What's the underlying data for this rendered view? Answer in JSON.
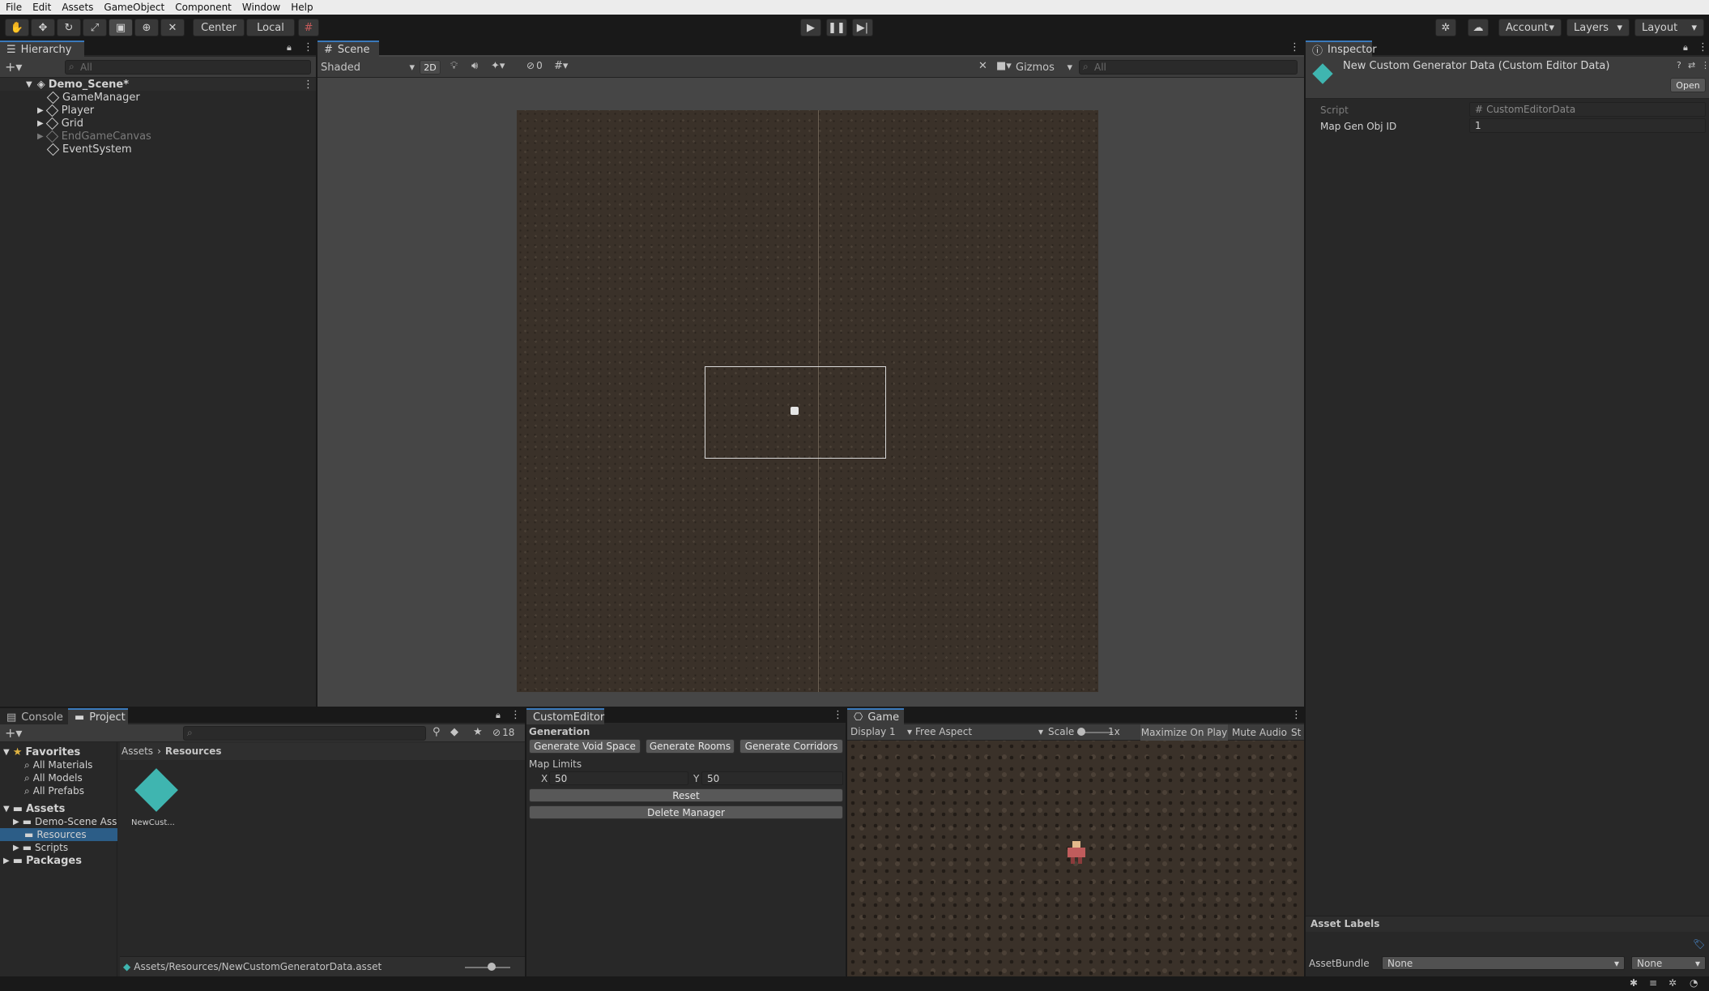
{
  "menu": [
    "File",
    "Edit",
    "Assets",
    "GameObject",
    "Component",
    "Window",
    "Help"
  ],
  "toolbar": {
    "center": "Center",
    "local": "Local",
    "account": "Account",
    "layers": "Layers",
    "layout": "Layout"
  },
  "hierarchy": {
    "tab": "Hierarchy",
    "search_placeholder": "All",
    "scene": "Demo_Scene*",
    "items": [
      "GameManager",
      "Player",
      "Grid",
      "EndGameCanvas",
      "EventSystem"
    ]
  },
  "scene": {
    "tab": "Scene",
    "shading": "Shaded",
    "mode_2d": "2D",
    "hidden_count": "0",
    "gizmos": "Gizmos",
    "search_placeholder": "All"
  },
  "inspector": {
    "tab": "Inspector",
    "title": "New Custom Generator Data (Custom Editor Data)",
    "open_button": "Open",
    "script_label": "Script",
    "script_value": "CustomEditorData",
    "map_gen_label": "Map Gen Obj ID",
    "map_gen_value": "1",
    "asset_labels": "Asset Labels",
    "assetbundle_label": "AssetBundle",
    "assetbundle_value": "None",
    "variant_value": "None"
  },
  "project": {
    "tab_console": "Console",
    "tab_project": "Project",
    "hidden_count": "18",
    "favorites": "Favorites",
    "fav_items": [
      "All Materials",
      "All Models",
      "All Prefabs"
    ],
    "assets": "Assets",
    "asset_folders": [
      "Demo-Scene Ass",
      "Resources",
      "Scripts"
    ],
    "packages": "Packages",
    "breadcrumb_root": "Assets",
    "breadcrumb_current": "Resources",
    "asset_name": "NewCust...",
    "status_path": "Assets/Resources/NewCustomGeneratorData.asset"
  },
  "custom_editor": {
    "tab": "CustomEditor",
    "generation": "Generation",
    "btn_void": "Generate Void Space",
    "btn_rooms": "Generate Rooms",
    "btn_corridors": "Generate Corridors",
    "map_limits": "Map Limits",
    "x_label": "X",
    "x_value": "50",
    "y_label": "Y",
    "y_value": "50",
    "reset": "Reset",
    "delete": "Delete Manager"
  },
  "game": {
    "tab": "Game",
    "display": "Display 1",
    "aspect": "Free Aspect",
    "scale_label": "Scale",
    "scale_value": "1x",
    "maximize": "Maximize On Play",
    "mute": "Mute Audio",
    "stats": "St"
  },
  "colors": {
    "accent": "#3a79bb",
    "diamond": "#3fb5b0",
    "floor": "#3a3129"
  }
}
